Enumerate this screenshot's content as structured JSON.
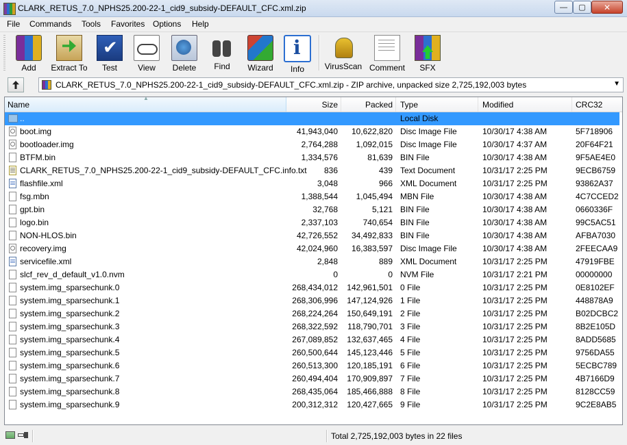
{
  "window": {
    "title": "CLARK_RETUS_7.0_NPHS25.200-22-1_cid9_subsidy-DEFAULT_CFC.xml.zip",
    "min_label": "—",
    "max_label": "▢",
    "close_label": "✕"
  },
  "menu": [
    {
      "ul": "F",
      "rest": "ile"
    },
    {
      "ul": "C",
      "rest": "ommands"
    },
    {
      "ul": "",
      "pre": "Too",
      "ul2": "l",
      "rest": "s"
    },
    {
      "ul": "",
      "pre": "Fav",
      "ul2": "o",
      "rest": "rites"
    },
    {
      "ul": "",
      "pre": "Optio",
      "ul2": "n",
      "rest": "s"
    },
    {
      "ul": "H",
      "rest": "elp"
    }
  ],
  "menu_labels": [
    "File",
    "Commands",
    "Tools",
    "Favorites",
    "Options",
    "Help"
  ],
  "toolbar": {
    "add": "Add",
    "extract": "Extract To",
    "test": "Test",
    "view": "View",
    "delete": "Delete",
    "find": "Find",
    "wizard": "Wizard",
    "info": "Info",
    "virusscan": "VirusScan",
    "comment": "Comment",
    "sfx": "SFX"
  },
  "address": {
    "text": "CLARK_RETUS_7.0_NPHS25.200-22-1_cid9_subsidy-DEFAULT_CFC.xml.zip - ZIP archive, unpacked size 2,725,192,003 bytes"
  },
  "columns": {
    "name": "Name",
    "size": "Size",
    "packed": "Packed",
    "type": "Type",
    "modified": "Modified",
    "crc": "CRC32"
  },
  "files": [
    {
      "name": "..",
      "size": "",
      "packed": "",
      "type": "Local Disk",
      "modified": "",
      "crc": "",
      "icon": "folder-icon",
      "selected": true
    },
    {
      "name": "boot.img",
      "size": "41,943,040",
      "packed": "10,622,820",
      "type": "Disc Image File",
      "modified": "10/30/17 4:38 AM",
      "crc": "5F718906",
      "icon": "disc-image-icon"
    },
    {
      "name": "bootloader.img",
      "size": "2,764,288",
      "packed": "1,092,015",
      "type": "Disc Image File",
      "modified": "10/30/17 4:37 AM",
      "crc": "20F64F21",
      "icon": "disc-image-icon"
    },
    {
      "name": "BTFM.bin",
      "size": "1,334,576",
      "packed": "81,639",
      "type": "BIN File",
      "modified": "10/30/17 4:38 AM",
      "crc": "9F5AE4E0",
      "icon": "file-icon"
    },
    {
      "name": "CLARK_RETUS_7.0_NPHS25.200-22-1_cid9_subsidy-DEFAULT_CFC.info.txt",
      "size": "836",
      "packed": "439",
      "type": "Text Document",
      "modified": "10/31/17 2:25 PM",
      "crc": "9ECB6759",
      "icon": "text-document-icon"
    },
    {
      "name": "flashfile.xml",
      "size": "3,048",
      "packed": "966",
      "type": "XML Document",
      "modified": "10/31/17 2:25 PM",
      "crc": "93862A37",
      "icon": "xml-document-icon"
    },
    {
      "name": "fsg.mbn",
      "size": "1,388,544",
      "packed": "1,045,494",
      "type": "MBN File",
      "modified": "10/30/17 4:38 AM",
      "crc": "4C7CCED2",
      "icon": "file-icon"
    },
    {
      "name": "gpt.bin",
      "size": "32,768",
      "packed": "5,121",
      "type": "BIN File",
      "modified": "10/30/17 4:38 AM",
      "crc": "0660336F",
      "icon": "file-icon"
    },
    {
      "name": "logo.bin",
      "size": "2,337,103",
      "packed": "740,654",
      "type": "BIN File",
      "modified": "10/30/17 4:38 AM",
      "crc": "99C5AC51",
      "icon": "file-icon"
    },
    {
      "name": "NON-HLOS.bin",
      "size": "42,726,552",
      "packed": "34,492,833",
      "type": "BIN File",
      "modified": "10/30/17 4:38 AM",
      "crc": "AFBA7030",
      "icon": "file-icon"
    },
    {
      "name": "recovery.img",
      "size": "42,024,960",
      "packed": "16,383,597",
      "type": "Disc Image File",
      "modified": "10/30/17 4:38 AM",
      "crc": "2FEECAA9",
      "icon": "disc-image-icon"
    },
    {
      "name": "servicefile.xml",
      "size": "2,848",
      "packed": "889",
      "type": "XML Document",
      "modified": "10/31/17 2:25 PM",
      "crc": "47919FBE",
      "icon": "xml-document-icon"
    },
    {
      "name": "slcf_rev_d_default_v1.0.nvm",
      "size": "0",
      "packed": "0",
      "type": "NVM File",
      "modified": "10/31/17 2:21 PM",
      "crc": "00000000",
      "icon": "file-icon"
    },
    {
      "name": "system.img_sparsechunk.0",
      "size": "268,434,012",
      "packed": "142,961,501",
      "type": "0 File",
      "modified": "10/31/17 2:25 PM",
      "crc": "0E8102EF",
      "icon": "file-icon"
    },
    {
      "name": "system.img_sparsechunk.1",
      "size": "268,306,996",
      "packed": "147,124,926",
      "type": "1 File",
      "modified": "10/31/17 2:25 PM",
      "crc": "448878A9",
      "icon": "file-icon"
    },
    {
      "name": "system.img_sparsechunk.2",
      "size": "268,224,264",
      "packed": "150,649,191",
      "type": "2 File",
      "modified": "10/31/17 2:25 PM",
      "crc": "B02DCBC2",
      "icon": "file-icon"
    },
    {
      "name": "system.img_sparsechunk.3",
      "size": "268,322,592",
      "packed": "118,790,701",
      "type": "3 File",
      "modified": "10/31/17 2:25 PM",
      "crc": "8B2E105D",
      "icon": "file-icon"
    },
    {
      "name": "system.img_sparsechunk.4",
      "size": "267,089,852",
      "packed": "132,637,465",
      "type": "4 File",
      "modified": "10/31/17 2:25 PM",
      "crc": "8ADD5685",
      "icon": "file-icon"
    },
    {
      "name": "system.img_sparsechunk.5",
      "size": "260,500,644",
      "packed": "145,123,446",
      "type": "5 File",
      "modified": "10/31/17 2:25 PM",
      "crc": "9756DA55",
      "icon": "file-icon"
    },
    {
      "name": "system.img_sparsechunk.6",
      "size": "260,513,300",
      "packed": "120,185,191",
      "type": "6 File",
      "modified": "10/31/17 2:25 PM",
      "crc": "5ECBC789",
      "icon": "file-icon"
    },
    {
      "name": "system.img_sparsechunk.7",
      "size": "260,494,404",
      "packed": "170,909,897",
      "type": "7 File",
      "modified": "10/31/17 2:25 PM",
      "crc": "4B7166D9",
      "icon": "file-icon"
    },
    {
      "name": "system.img_sparsechunk.8",
      "size": "268,435,064",
      "packed": "185,466,888",
      "type": "8 File",
      "modified": "10/31/17 2:25 PM",
      "crc": "8128CC59",
      "icon": "file-icon"
    },
    {
      "name": "system.img_sparsechunk.9",
      "size": "200,312,312",
      "packed": "120,427,665",
      "type": "9 File",
      "modified": "10/31/17 2:25 PM",
      "crc": "9C2E8AB5",
      "icon": "file-icon"
    }
  ],
  "status": {
    "text": "Total 2,725,192,003 bytes in 22 files"
  },
  "colors": {
    "selection": "#3399ff",
    "titlebar": "#c9d9ee"
  }
}
